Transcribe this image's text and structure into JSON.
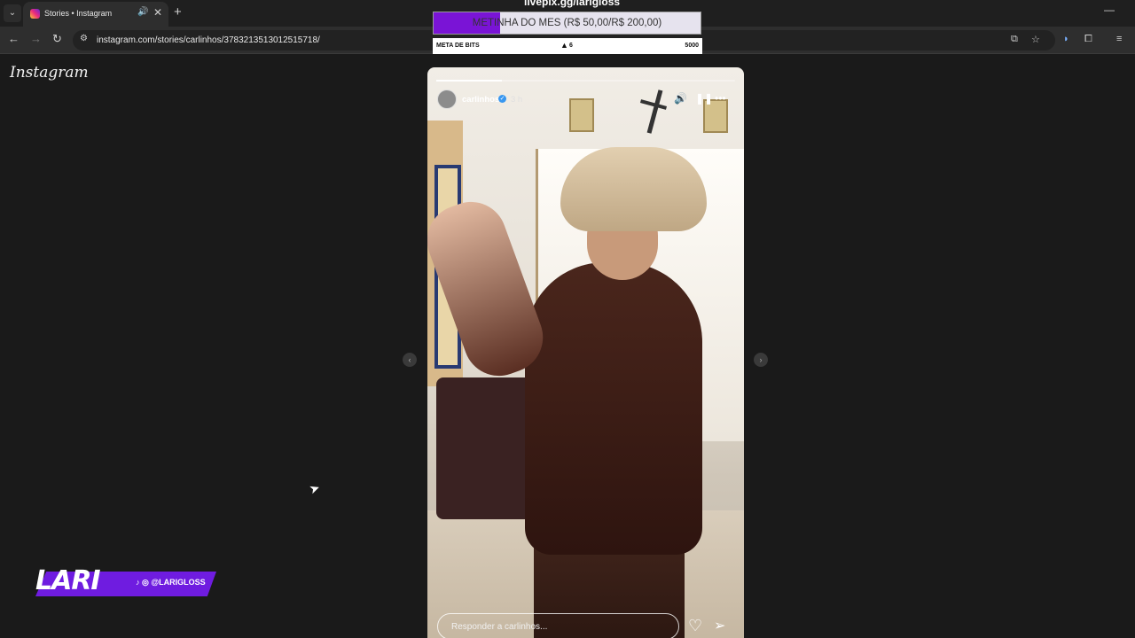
{
  "browser": {
    "tab_title": "Stories • Instagram",
    "url": "instagram.com/stories/carlinhos/3783213513012515718/"
  },
  "overlay": {
    "site": "livepix.gg/larigloss",
    "goal_text": "METINHA DO MES (R$ 50,00/R$ 200,00)",
    "goal_progress": 0.25,
    "bits_label": "META DE BITS",
    "bits_value": "6",
    "bits_target": "5000"
  },
  "instagram": {
    "logo": "Instagram"
  },
  "story": {
    "username": "carlinhos",
    "time": "3 h",
    "reply_placeholder": "Responder a carlinhos...",
    "progress": 0.22
  },
  "streamer": {
    "name": "LARI",
    "handle": "@LARIGLOSS"
  },
  "icons": {
    "tab_menu": "chevron-down-icon",
    "favicon": "instagram-icon",
    "audio": "speaker-icon",
    "close": "close-icon",
    "new_tab": "plus-icon",
    "back": "arrow-left-icon",
    "forward": "arrow-right-icon",
    "reload": "reload-icon",
    "site_info": "tune-icon",
    "install": "install-icon",
    "star": "star-icon",
    "extension": "puzzle-icon",
    "mute": "speaker-icon",
    "pause": "pause-icon",
    "more": "more-icon",
    "heart": "heart-icon",
    "send": "send-icon"
  },
  "colors": {
    "goal_fill": "#7a14d6",
    "badge": "#6f1ce0",
    "verified": "#3897f0"
  }
}
